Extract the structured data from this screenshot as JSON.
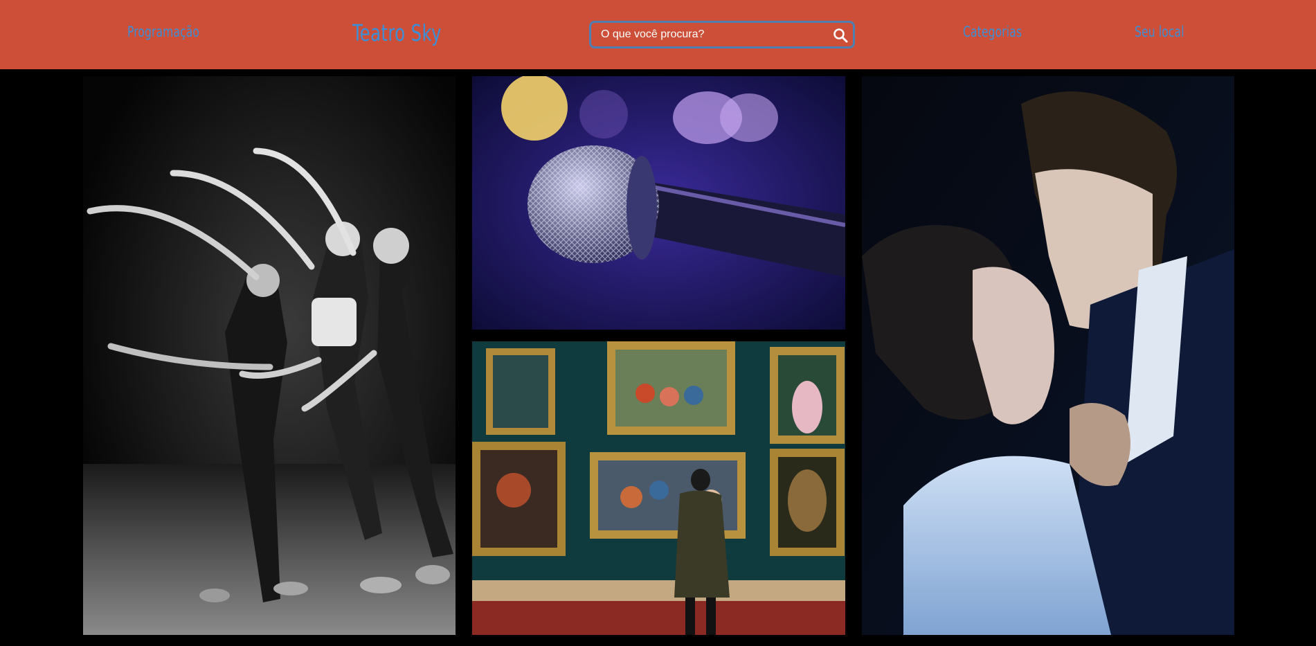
{
  "header": {
    "nav_left": "Programação",
    "brand": "Teatro Sky",
    "search": {
      "placeholder": "O que você procura?",
      "value": ""
    },
    "nav_categories": "Categorias",
    "nav_location": "Seu local"
  },
  "colors": {
    "header_bg": "#cd4f37",
    "link_blue": "#3c8fd6",
    "search_border": "#4f80b3",
    "page_bg": "#000000"
  },
  "icons": {
    "search": "search-icon"
  }
}
